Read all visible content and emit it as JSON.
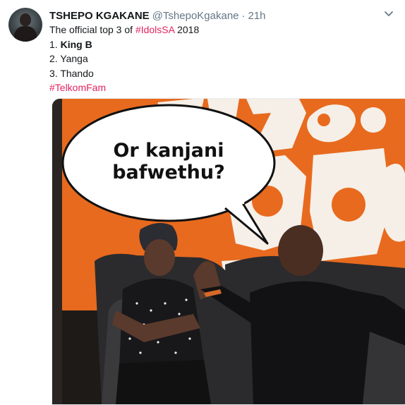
{
  "tweet": {
    "author_name": "TSHEPO KGAKANE",
    "author_handle": "@TshepoKgakane",
    "separator": "·",
    "time": "21h",
    "line1_prefix": "The official top 3 of ",
    "line1_hashtag": "#IdolsSA",
    "line1_suffix": " 2018",
    "ranking": [
      {
        "prefix": "1. ",
        "name": "King B"
      },
      {
        "prefix": "2. ",
        "name": "Yanga"
      },
      {
        "prefix": "3. ",
        "name": "Thando"
      }
    ],
    "closing_hashtag": "#TelkomFam"
  },
  "media": {
    "speech_line1": "Or kanjani",
    "speech_line2": "bafwethu?",
    "wall_color": "#e86a1e",
    "sofa_color": "#2b2b2d"
  },
  "colors": {
    "hashtag": "#e0245e",
    "secondary_text": "#657786"
  },
  "icons": {
    "menu": "chevron-down-icon"
  }
}
